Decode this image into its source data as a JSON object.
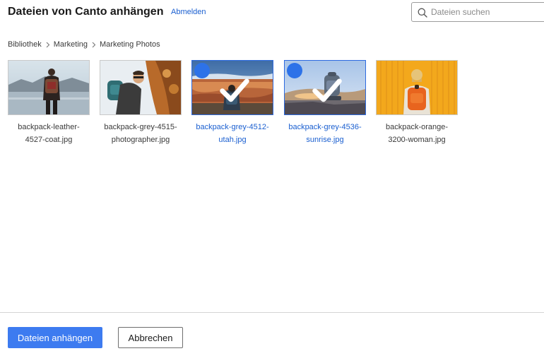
{
  "header": {
    "title": "Dateien von Canto anhängen",
    "logout_label": "Abmelden"
  },
  "search": {
    "placeholder": "Dateien suchen",
    "value": ""
  },
  "breadcrumb": [
    "Bibliothek",
    "Marketing",
    "Marketing Photos"
  ],
  "files": [
    {
      "name_line1": "backpack-leather-",
      "name_line2": "4527-coat.jpg",
      "selected": false
    },
    {
      "name_line1": "backpack-grey-4515-",
      "name_line2": "photographer.jpg",
      "selected": false
    },
    {
      "name_line1": "backpack-grey-4512-",
      "name_line2": "utah.jpg",
      "selected": true
    },
    {
      "name_line1": "backpack-grey-4536-",
      "name_line2": "sunrise.jpg",
      "selected": true
    },
    {
      "name_line1": "backpack-orange-",
      "name_line2": "3200-woman.jpg",
      "selected": false
    }
  ],
  "footer": {
    "attach_label": "Dateien anhängen",
    "cancel_label": "Abbrechen"
  },
  "colors": {
    "accent": "#3d7bf0",
    "link": "#1a5fd0",
    "selected_border": "#2d6ae0"
  },
  "icons": {
    "search": "search-icon",
    "separator": "chevron-right-icon",
    "check": "check-icon"
  }
}
